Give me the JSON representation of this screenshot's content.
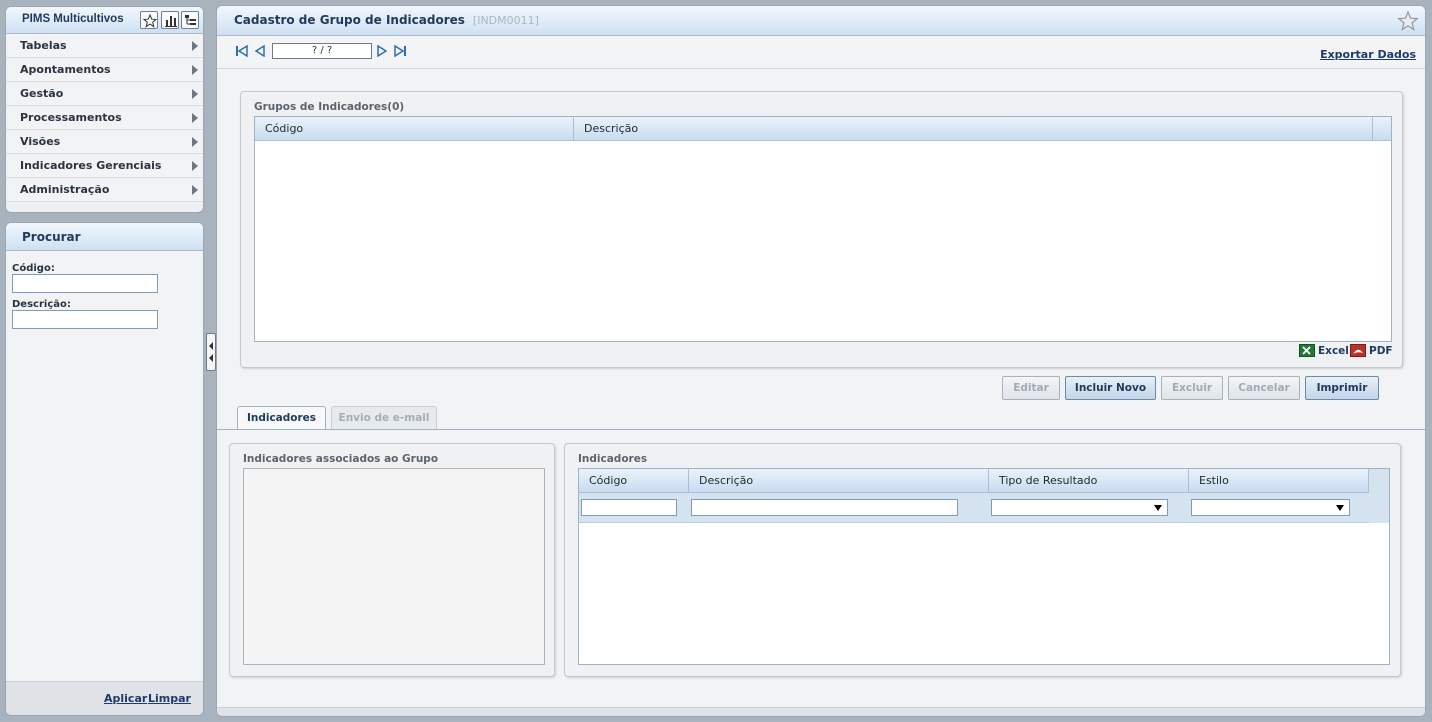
{
  "app": {
    "title": "PIMS Multicultivos",
    "header_icons": [
      "star-icon",
      "bar-chart-icon",
      "tree-list-icon"
    ]
  },
  "menu": {
    "items": [
      {
        "label": "Tabelas"
      },
      {
        "label": "Apontamentos"
      },
      {
        "label": "Gestão"
      },
      {
        "label": "Processamentos"
      },
      {
        "label": "Visões"
      },
      {
        "label": "Indicadores Gerenciais"
      },
      {
        "label": "Administração"
      }
    ]
  },
  "search": {
    "title": "Procurar",
    "codigo_label": "Código:",
    "codigo_value": "",
    "descricao_label": "Descrição:",
    "descricao_value": "",
    "apply_label": "Aplicar",
    "clear_label": "Limpar"
  },
  "page": {
    "title": "Cadastro de Grupo de Indicadores",
    "code": "[INDM0011]",
    "pager": "? / ?",
    "export_label": "Exportar Dados"
  },
  "groups": {
    "title": "Grupos de Indicadores(0)",
    "columns": [
      "Código",
      "Descrição"
    ],
    "rows": [],
    "excel_label": "Excel",
    "pdf_label": "PDF"
  },
  "actions": {
    "edit": "Editar",
    "new": "Incluir Novo",
    "delete": "Excluir",
    "cancel": "Cancelar",
    "print": "Imprimir"
  },
  "tabs": [
    {
      "label": "Indicadores",
      "active": true
    },
    {
      "label": "Envio de e-mail",
      "active": false
    }
  ],
  "associated": {
    "title": "Indicadores associados ao Grupo"
  },
  "indicators": {
    "title": "Indicadores",
    "columns": [
      "Código",
      "Descrição",
      "Tipo de Resultado",
      "Estilo"
    ],
    "filters": {
      "codigo": "",
      "descricao": "",
      "tipo": "",
      "estilo": ""
    },
    "rows": []
  },
  "colors": {
    "header_gradient_top": "#f2f7fd",
    "header_gradient_bottom": "#cfe0f2",
    "title_text": "#1e3a5c",
    "background": "#a9b3bd"
  }
}
